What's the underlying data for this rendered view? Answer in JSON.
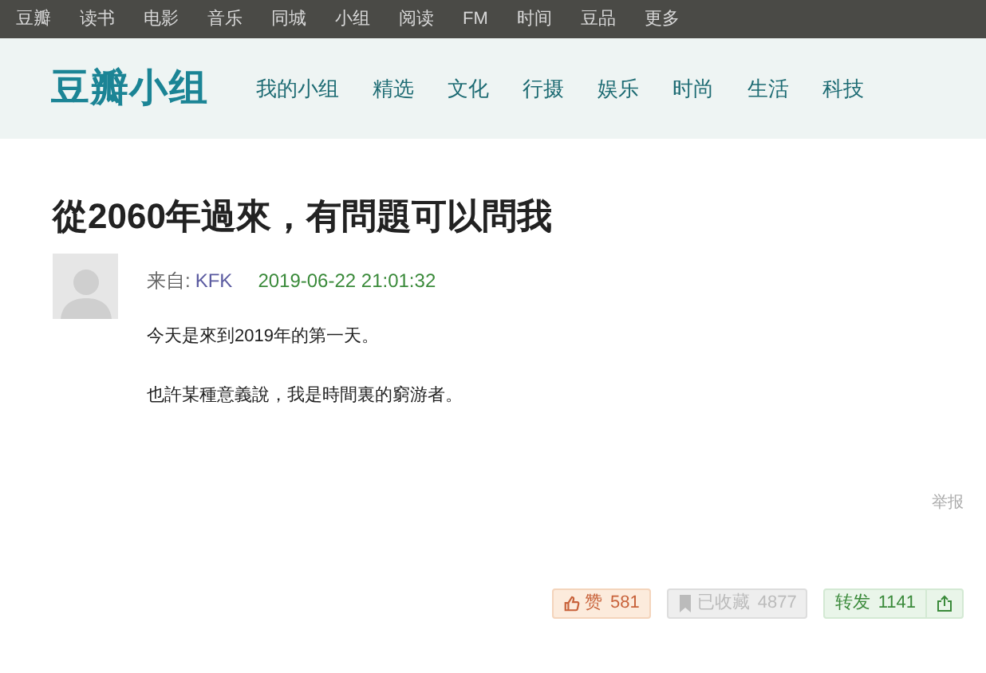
{
  "top_nav": [
    "豆瓣",
    "读书",
    "电影",
    "音乐",
    "同城",
    "小组",
    "阅读",
    "FM",
    "时间",
    "豆品",
    "更多"
  ],
  "header": {
    "logo": "豆瓣小组",
    "nav": [
      "我的小组",
      "精选",
      "文化",
      "行摄",
      "娱乐",
      "时尚",
      "生活",
      "科技"
    ]
  },
  "post": {
    "title": "從2060年過來，有問題可以問我",
    "from_label": "来自:",
    "author": "KFK",
    "time": "2019-06-22 21:01:32",
    "paragraphs": [
      "今天是來到2019年的第一天。",
      "也許某種意義說，我是時間裏的窮游者。"
    ],
    "report": "举报"
  },
  "actions": [
    {
      "kind": "like",
      "label": "赞",
      "count": "581"
    },
    {
      "kind": "collect",
      "label": "已收藏",
      "count": "4877"
    },
    {
      "kind": "share",
      "label": "转发",
      "count": "1141"
    }
  ]
}
